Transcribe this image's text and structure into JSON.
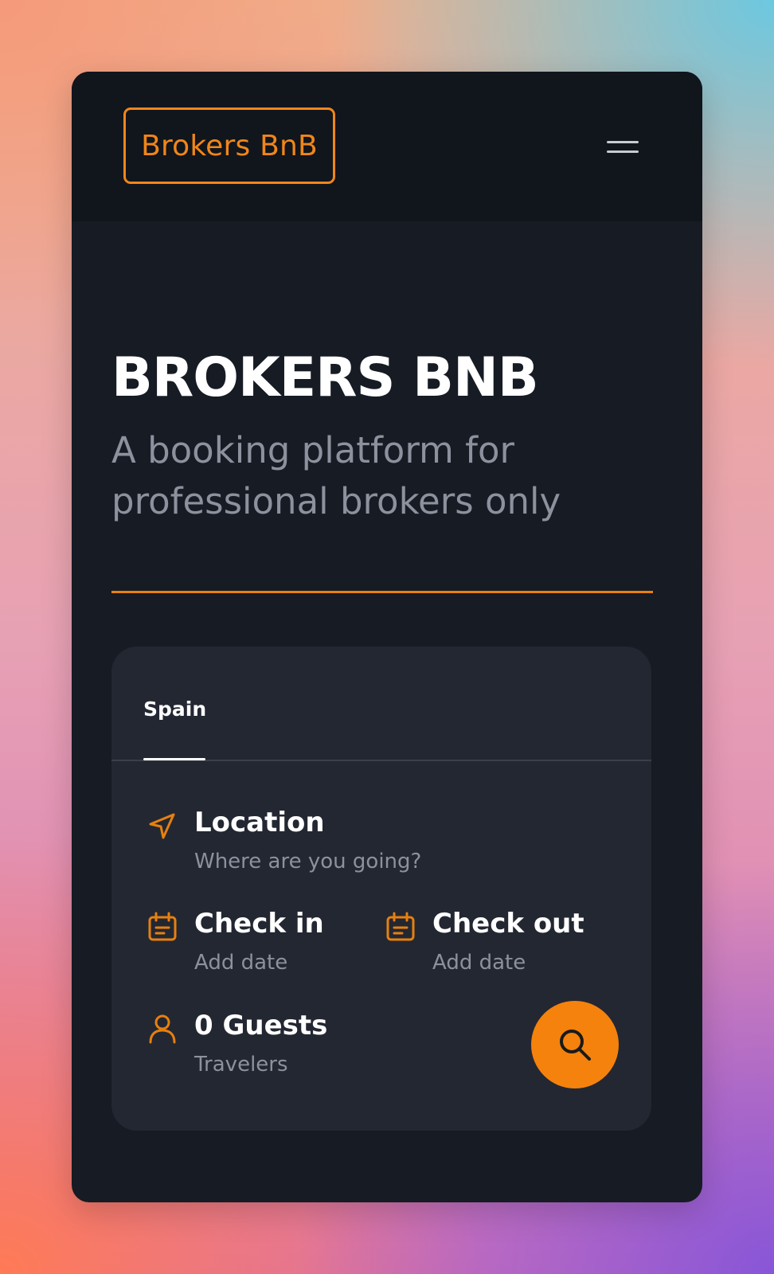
{
  "header": {
    "logo_text": "Brokers BnB",
    "menu_icon": "hamburger-menu-icon"
  },
  "hero": {
    "title": "BROKERS BNB",
    "subtitle": "A booking platform for professional brokers only"
  },
  "search_card": {
    "tabs": [
      {
        "label": "Spain",
        "active": true
      }
    ],
    "location": {
      "label": "Location",
      "hint": "Where are you going?",
      "icon": "navigation-arrow-icon"
    },
    "check_in": {
      "label": "Check in",
      "hint": "Add date",
      "icon": "calendar-icon"
    },
    "check_out": {
      "label": "Check out",
      "hint": "Add date",
      "icon": "calendar-icon"
    },
    "guests": {
      "label": "0 Guests",
      "hint": "Travelers",
      "icon": "user-icon"
    },
    "search_icon": "search-icon"
  },
  "colors": {
    "accent": "#f5820c",
    "panel": "#161b24",
    "card": "#232732",
    "muted_text": "#8c919d"
  }
}
